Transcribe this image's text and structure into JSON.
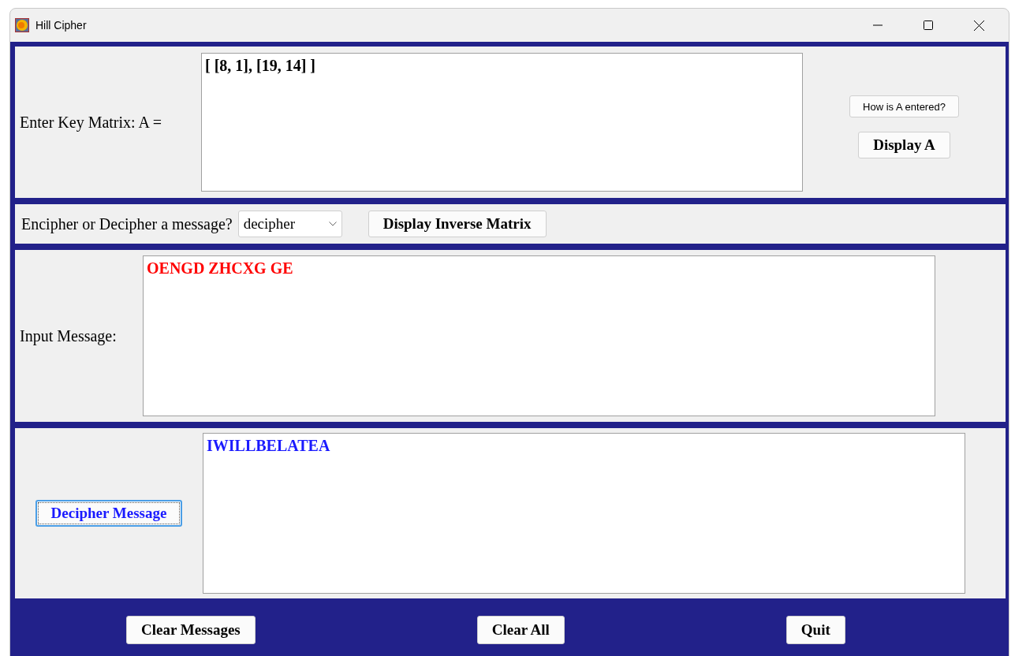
{
  "window": {
    "title": "Hill Cipher"
  },
  "key_section": {
    "label": "Enter Key Matrix: A =",
    "key_matrix": "[ [8, 1], [19, 14] ]",
    "help_button": "How is A entered?",
    "display_button": "Display A"
  },
  "mode_section": {
    "label": "Encipher or Decipher a message?",
    "mode": "decipher",
    "inverse_button": "Display Inverse Matrix"
  },
  "input_section": {
    "label": "Input Message:",
    "message": "OENGD ZHCXG GE"
  },
  "output_section": {
    "action_button": "Decipher Message",
    "result": "IWILLBELATEA"
  },
  "bottom_buttons": [
    "Clear Messages",
    "Clear All",
    "Quit"
  ]
}
